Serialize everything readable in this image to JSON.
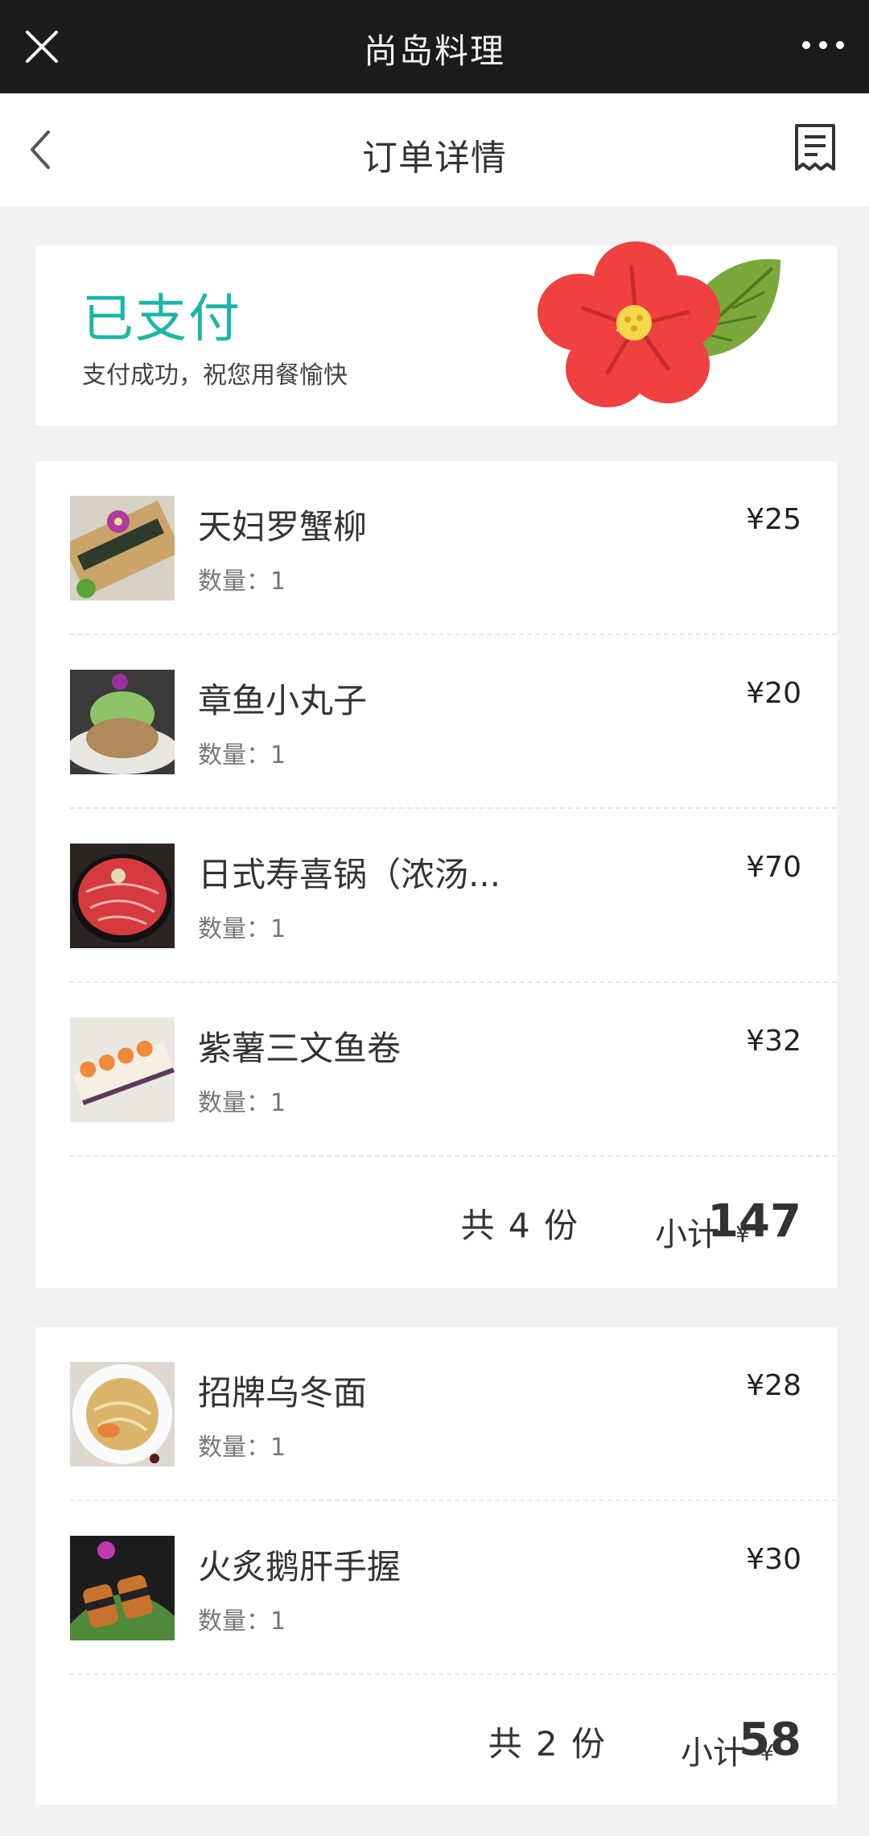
{
  "top_bar": {
    "title": "尚岛料理"
  },
  "nav_bar": {
    "title": "订单详情"
  },
  "status": {
    "title": "已支付",
    "subtitle": "支付成功，祝您用餐愉快"
  },
  "groups": [
    {
      "items": [
        {
          "name": "天妇罗蟹柳",
          "qty": "数量：1",
          "price": "¥25"
        },
        {
          "name": "章鱼小丸子",
          "qty": "数量：1",
          "price": "¥20"
        },
        {
          "name": "日式寿喜锅（浓汤...",
          "qty": "数量：1",
          "price": "¥70"
        },
        {
          "name": "紫薯三文鱼卷",
          "qty": "数量：1",
          "price": "¥32"
        }
      ],
      "count": "共 4 份",
      "subtotal_label": "小计",
      "currency": "¥",
      "subtotal": "147"
    },
    {
      "items": [
        {
          "name": "招牌乌冬面",
          "qty": "数量：1",
          "price": "¥28"
        },
        {
          "name": "火炙鹅肝手握",
          "qty": "数量：1",
          "price": "¥30"
        }
      ],
      "count": "共 2 份",
      "subtotal_label": "小计",
      "currency": "¥",
      "subtotal": "58"
    }
  ],
  "colors": {
    "accent": "#1ab7a5",
    "top_bar": "#1b1b1b"
  }
}
